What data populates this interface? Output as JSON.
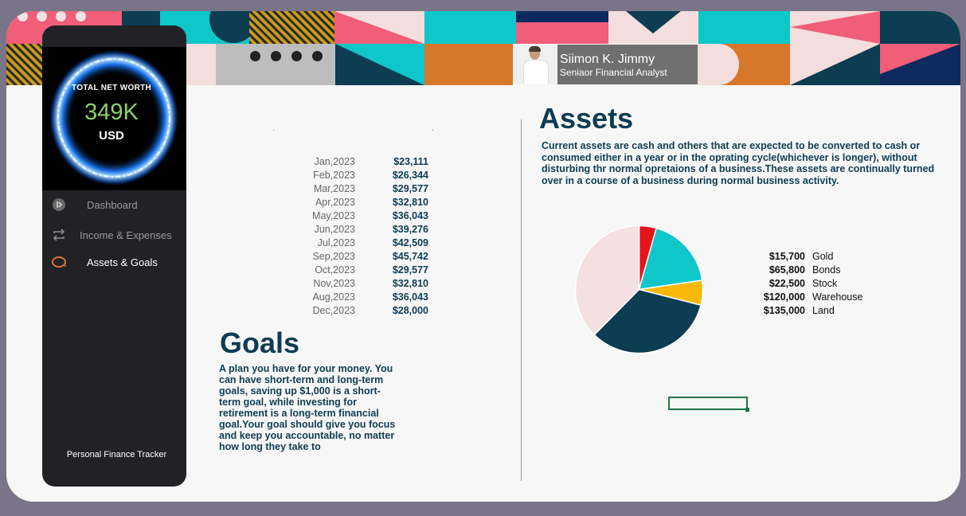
{
  "profile": {
    "name": "Siimon K. Jimmy",
    "role": "Seniaor Financial Analyst"
  },
  "net_worth": {
    "title": "TOTAL NET WORTH",
    "value": "349K",
    "unit": "USD"
  },
  "nav": {
    "items": [
      {
        "label": "Dashboard",
        "icon": "dashboard-icon",
        "active": false
      },
      {
        "label": "Income & Expenses",
        "icon": "repeat-icon",
        "active": false
      },
      {
        "label": "Assets & Goals",
        "icon": "money-icon",
        "active": true
      }
    ]
  },
  "footer": {
    "label": "Personal Finance Tracker"
  },
  "monthly": [
    {
      "month": "Jan,2023",
      "value": "$23,111"
    },
    {
      "month": "Feb,2023",
      "value": "$26,344"
    },
    {
      "month": "Mar,2023",
      "value": "$29,577"
    },
    {
      "month": "Apr,2023",
      "value": "$32,810"
    },
    {
      "month": "May,2023",
      "value": "$36,043"
    },
    {
      "month": "Jun,2023",
      "value": "$39,276"
    },
    {
      "month": "Jul,2023",
      "value": "$42,509"
    },
    {
      "month": "Sep,2023",
      "value": "$45,742"
    },
    {
      "month": "Oct,2023",
      "value": "$29,577"
    },
    {
      "month": "Nov,2023",
      "value": "$32,810"
    },
    {
      "month": "Aug,2023",
      "value": "$36,043"
    },
    {
      "month": "Dec,2023",
      "value": "$28,000"
    }
  ],
  "goals": {
    "title": "Goals",
    "text": "A plan you have for your money. You can have short-term and long-term goals, saving up $1,000 is a short-term goal, while investing for retirement is a long-term financial goal.Your goal  should give you focus and keep you accountable, no matter how long they take to"
  },
  "assets": {
    "title": "Assets",
    "text": "Current assets are cash and others that are expected to be converted to  cash or consumed either in a year or in the oprating cycle(whichever is longer), without disturbing thr normal opretaions of a business.These assets are continually turned over in a course of a business during normal business activity."
  },
  "chart_data": {
    "type": "pie",
    "categories": [
      "Gold",
      "Bonds",
      "Stock",
      "Warehouse",
      "Land"
    ],
    "values": [
      15700,
      65800,
      22500,
      120000,
      135000
    ],
    "labels": [
      "$15,700",
      "$65,800",
      "$22,500",
      "$120,000",
      "$135,000"
    ],
    "colors": [
      "#e8141c",
      "#0fc6c9",
      "#f7b80a",
      "#0c3d52",
      "#f4e0e0"
    ],
    "legend": "right"
  }
}
